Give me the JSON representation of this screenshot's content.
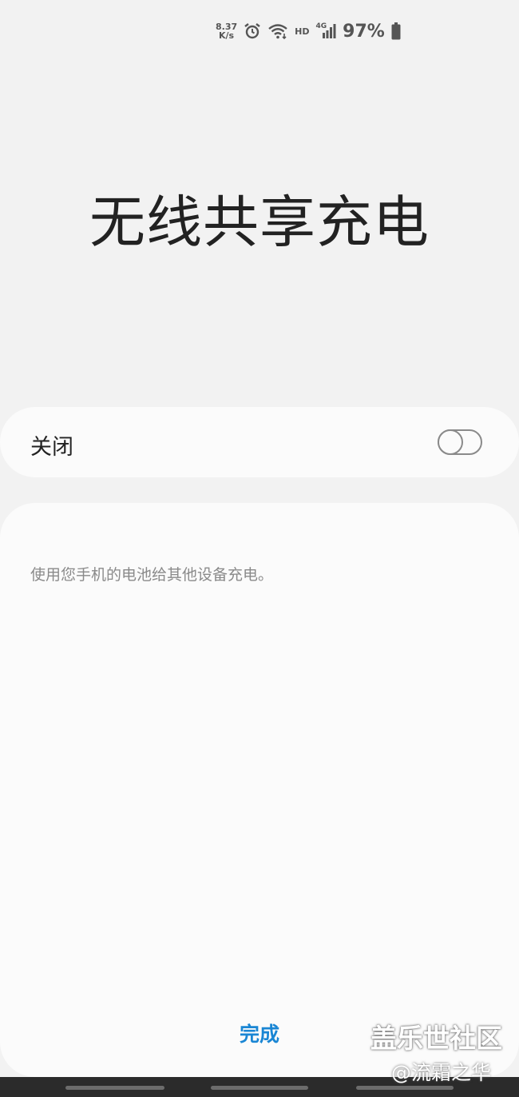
{
  "status_bar": {
    "net_speed_value": "8.37",
    "net_speed_unit": "K/s",
    "icons": [
      "alarm-icon",
      "wifi-icon",
      "hd-icon",
      "signal-4g-icon",
      "battery-icon"
    ],
    "hd_label": "HD",
    "network_label": "4G",
    "battery_percent": "97%"
  },
  "page": {
    "title": "无线共享充电"
  },
  "toggle": {
    "label": "关闭",
    "state": "off",
    "colors": {
      "outline": "#8a8a8a"
    }
  },
  "content": {
    "description": "使用您手机的电池给其他设备充电。"
  },
  "footer": {
    "done_label": "完成",
    "accent_color": "#1a86d4"
  },
  "watermark": {
    "line1": "盖乐世社区",
    "line2": "@流霜之华"
  }
}
